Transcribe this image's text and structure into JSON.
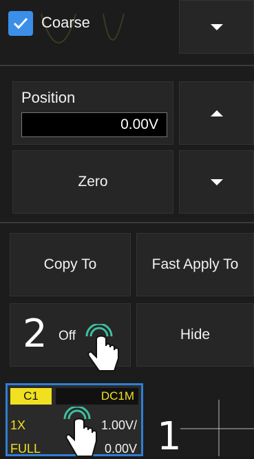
{
  "coarse": {
    "label": "Coarse",
    "checked": true
  },
  "position": {
    "label": "Position",
    "value": "0.00V"
  },
  "buttons": {
    "zero": "Zero",
    "copy_to": "Copy To",
    "fast_apply_to": "Fast Apply To",
    "off": "Off",
    "hide": "Hide"
  },
  "annotations": {
    "step2": "2",
    "step1": "1"
  },
  "channel": {
    "name": "C1",
    "coupling": "DC1M",
    "probe": "1X",
    "bandwidth": "FULL",
    "scale": "1.00V/",
    "offset": "0.00V"
  },
  "colors": {
    "accent": "#3b8fe8",
    "channel": "#f0e020",
    "selection": "#2f7fd6"
  }
}
